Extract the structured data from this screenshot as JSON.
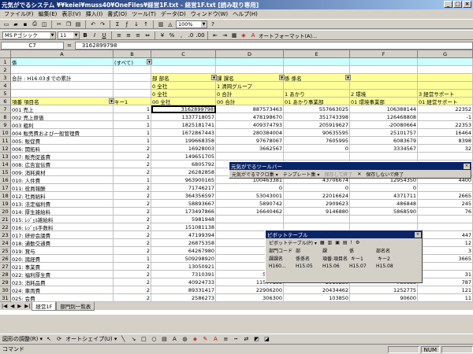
{
  "window": {
    "title": "元気がでるシステム  ¥¥keiei¥muss40¥OneFiles¥経営1F.txt - 経営1F.txt  [読み取り専用]"
  },
  "menu": [
    "ファイル(F)",
    "編集(E)",
    "表示(V)",
    "挿入(I)",
    "書式(O)",
    "ツール(T)",
    "データ(D)",
    "ウィンドウ(W)",
    "ヘルプ(H)"
  ],
  "toolbar": {
    "zoom": "100%",
    "font": "MS Pゴシック",
    "size": "11",
    "autoformat": "オートフォーマット(A)..."
  },
  "formula": {
    "namebox": "C7",
    "eq": "=",
    "value": "3162899798"
  },
  "columns": [
    "A",
    "B",
    "C",
    "D",
    "E",
    "F",
    "G"
  ],
  "rows": [
    {
      "n": "1",
      "a": "係",
      "b": "(すべて)",
      "c": "",
      "d": "",
      "e": "",
      "f": "",
      "g": ""
    },
    {
      "n": "2",
      "a": "",
      "b": "",
      "c": "",
      "d": "",
      "e": "",
      "f": "",
      "g": ""
    },
    {
      "n": "3",
      "a": "合計 : H16.03までの累計",
      "b": "",
      "c": "部 部名",
      "d": "課 課名",
      "e": "係 係名",
      "f": "",
      "g": ""
    },
    {
      "n": "4",
      "a": "",
      "b": "",
      "c": "0 全社",
      "d": "1 清岡グループ",
      "e": "",
      "f": "",
      "g": ""
    },
    {
      "n": "5",
      "a": "",
      "b": "",
      "c": "0 全社",
      "d": "0 合計",
      "e": "1 あかり",
      "f": "2 環境",
      "g": "3 経営サポート"
    },
    {
      "n": "6",
      "a": "項番 項目名",
      "b": "キー1",
      "c": "00 全社",
      "d": "00 合計",
      "e": "01 あかり事業部",
      "f": "01 環境事業部",
      "g": "01 経営サポート"
    },
    {
      "n": "7",
      "a": "001 売上",
      "b": "1",
      "c": "3162899798",
      "d": "887573463",
      "e": "557663025",
      "f": "106388144",
      "g": "22352"
    },
    {
      "n": "8",
      "a": "002 売上原価",
      "b": "1",
      "c": "1337718057",
      "d": "478198670",
      "e": "351743398",
      "f": "126468808",
      "g": "-1"
    },
    {
      "n": "9",
      "a": "003 粗利",
      "b": "1",
      "c": "1825181741",
      "d": "409374793",
      "e": "205919627",
      "f": "-20080664",
      "g": "22353"
    },
    {
      "n": "10",
      "a": "004 販売費および一般管理費",
      "b": "1",
      "c": "1672867443",
      "d": "280384004",
      "e": "90635595",
      "f": "25101757",
      "g": "16464"
    },
    {
      "n": "11",
      "a": "005:   販促費",
      "b": "1",
      "c": "199668358",
      "d": "97678067",
      "e": "7605995",
      "f": "6083679",
      "g": "8398"
    },
    {
      "n": "12",
      "a": "006:        開拓料",
      "b": "2",
      "c": "16928003",
      "d": "3662567",
      "e": "0",
      "f": "3334567",
      "g": "32"
    },
    {
      "n": "13",
      "a": "007:        販売促進費",
      "b": "2",
      "c": "149651705",
      "d": "",
      "e": "",
      "f": "",
      "g": ""
    },
    {
      "n": "14",
      "a": "008:        広告宣伝費",
      "b": "2",
      "c": "6805792",
      "d": "",
      "e": "",
      "f": "",
      "g": ""
    },
    {
      "n": "15",
      "a": "009:        消耗資材",
      "b": "2",
      "c": "26282858",
      "d": "",
      "e": "",
      "f": "",
      "g": ""
    },
    {
      "n": "16",
      "a": "010:   人件費",
      "b": "1",
      "c": "963900165",
      "d": "100463381",
      "e": "43706674",
      "f": "12954350",
      "g": "4400"
    },
    {
      "n": "17",
      "a": "011:        役員報酬",
      "b": "2",
      "c": "71746217",
      "d": "0",
      "e": "0",
      "f": "0",
      "g": ""
    },
    {
      "n": "18",
      "a": "012:        社員給料",
      "b": "2",
      "c": "364356597",
      "d": "53043001",
      "e": "22016624",
      "f": "4371711",
      "g": "2665"
    },
    {
      "n": "19",
      "a": "013:        法定福利費",
      "b": "2",
      "c": "58893667",
      "d": "5890742",
      "e": "2909623",
      "f": "486848",
      "g": "245"
    },
    {
      "n": "20",
      "a": "014:        厚生雑給料",
      "b": "2",
      "c": "173497866",
      "d": "16640462",
      "e": "9146880",
      "f": "5868590",
      "g": "76"
    },
    {
      "n": "21",
      "a": "015:        ﾚｼﾞｪﾙ雑給料",
      "b": "2",
      "c": "5981948",
      "d": "",
      "e": "",
      "f": "",
      "g": ""
    },
    {
      "n": "22",
      "a": "016:        ﾚｼﾞｪﾙ手数料",
      "b": "2",
      "c": "151081138",
      "d": "",
      "e": "",
      "f": "",
      "g": ""
    },
    {
      "n": "23",
      "a": "017:        研修会議費",
      "b": "2",
      "c": "47199394",
      "d": "",
      "e": "",
      "f": "",
      "g": "447"
    },
    {
      "n": "24",
      "a": "018:        通勤交通費",
      "b": "2",
      "c": "26875358",
      "d": "",
      "e": "",
      "f": "",
      "g": "12"
    },
    {
      "n": "25",
      "a": "019:        賞与",
      "b": "2",
      "c": "64267980",
      "d": "",
      "e": "",
      "f": "",
      "g": "3"
    },
    {
      "n": "26",
      "a": "020:   諸経費",
      "b": "1",
      "c": "509298920",
      "d": "",
      "e": "",
      "f": "",
      "g": "3665"
    },
    {
      "n": "27",
      "a": "021:        事業費",
      "b": "2",
      "c": "13050921",
      "d": "",
      "e": "",
      "f": "",
      "g": ""
    },
    {
      "n": "28",
      "a": "022:        福利厚生費",
      "b": "2",
      "c": "7310391",
      "d": "522755",
      "e": "163651",
      "f": "40916",
      "g": "31"
    },
    {
      "n": "29",
      "a": "023:        消耗品費",
      "b": "2",
      "c": "40924733",
      "d": "11577185",
      "e": "2919238",
      "f": "780658",
      "g": "787"
    },
    {
      "n": "30",
      "a": "024:        車両費",
      "b": "2",
      "c": "89331417",
      "d": "22906200",
      "e": "20434462",
      "f": "1252775",
      "g": "121"
    },
    {
      "n": "31",
      "a": "025:        会費",
      "b": "2",
      "c": "2586273",
      "d": "306300",
      "e": "103850",
      "f": "90600",
      "g": "11"
    },
    {
      "n": "32",
      "a": "026:        支払ﾛｲﾔﾘﾃｨｰ",
      "b": "2",
      "c": "18224482",
      "d": "0",
      "e": "0",
      "f": "0",
      "g": ""
    }
  ],
  "sheets": [
    "経営1F",
    "部門別一覧表"
  ],
  "toolbarWin": {
    "title": "元気がでるツールバー",
    "macro": "元気がでるマクロ集 ▾",
    "template": "テンプレート集 ▾",
    "save_disabled": "保存して終了",
    "save_no": "保存しないで終了"
  },
  "pivot": {
    "title": "ピボットテーブル",
    "menu": "ピボットテーブル(P) ▾",
    "fields1": [
      "部門コード",
      "部",
      "課",
      "係",
      "部名名"
    ],
    "fields2": [
      "課課名",
      "係係名",
      "項番:項目名",
      "キー1",
      "キー2"
    ],
    "fields3": [
      "H160...",
      "H15.05",
      "H15.06",
      "H15.07",
      "H15.08"
    ]
  },
  "drawbar": {
    "draw": "図形の調整(R) ▾",
    "autoshape": "オートシェイプ(U) ▾"
  },
  "status": {
    "left": "コマンド",
    "num": "NUM"
  }
}
